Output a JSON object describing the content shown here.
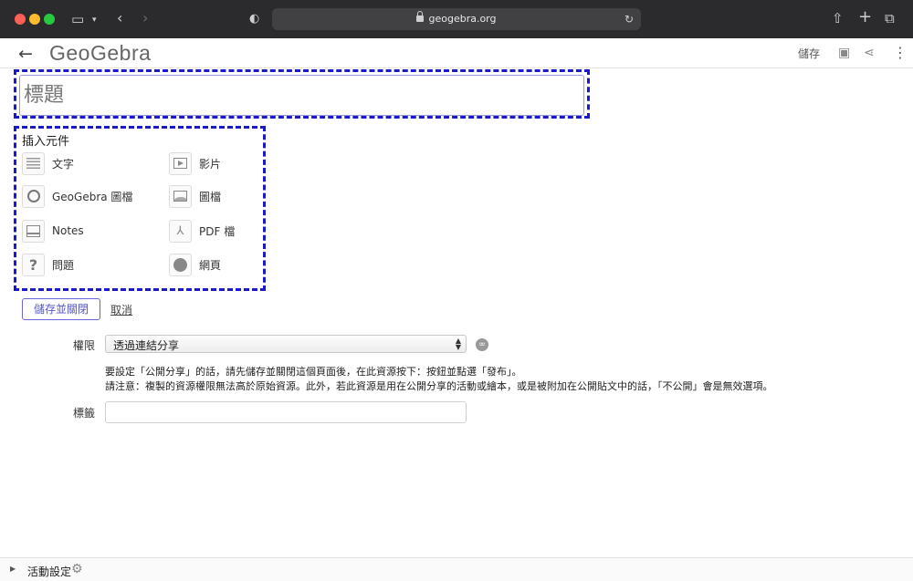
{
  "browser": {
    "url": "geogebra.org"
  },
  "header": {
    "logo_text": "GeoGebra",
    "save_label": "儲存"
  },
  "title_field": {
    "placeholder": "標題"
  },
  "insert": {
    "heading": "插入元件",
    "items": [
      {
        "label": "文字",
        "icon": "text-lines-icon"
      },
      {
        "label": "影片",
        "icon": "video-icon"
      },
      {
        "label": "GeoGebra 圖檔",
        "icon": "geogebra-icon"
      },
      {
        "label": "圖檔",
        "icon": "image-icon"
      },
      {
        "label": "Notes",
        "icon": "notes-icon"
      },
      {
        "label": "PDF 檔",
        "icon": "pdf-icon"
      },
      {
        "label": "問題",
        "icon": "question-icon"
      },
      {
        "label": "網頁",
        "icon": "web-page-icon"
      }
    ]
  },
  "actions": {
    "save_close": "儲存並關閉",
    "cancel": "取消"
  },
  "permissions": {
    "label": "權限",
    "selected": "透過連結分享",
    "info_line1": "要設定「公開分享」的話，請先儲存並關閉這個頁面後，在此資源按下：按鈕並點選「發布」。",
    "info_line2": "請注意：複製的資源權限無法高於原始資源。此外，若此資源是用在公開分享的活動或繪本，或是被附加在公開貼文中的話，「不公開」會是無效選項。"
  },
  "tags": {
    "label": "標籤",
    "value": ""
  },
  "footer": {
    "label": "活動設定"
  }
}
